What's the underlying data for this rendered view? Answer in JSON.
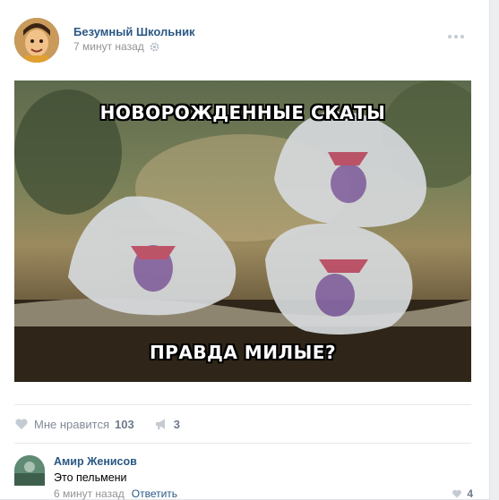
{
  "post": {
    "author": "Безумный Школьник",
    "time": "7 минут назад",
    "image": {
      "top_text": "НОВОРОЖДЕННЫЕ СКАТЫ",
      "bottom_text": "ПРАВДА МИЛЫЕ?"
    },
    "actions": {
      "like_label": "Мне нравится",
      "like_count": "103",
      "share_count": "3"
    }
  },
  "comment": {
    "author": "Амир Женисов",
    "text": "Это пельмени",
    "time": "6 минут назад",
    "reply_label": "Ответить",
    "like_count": "4"
  },
  "colors": {
    "link": "#2a5885",
    "meta": "#939393",
    "icon": "#c5cbd3"
  }
}
